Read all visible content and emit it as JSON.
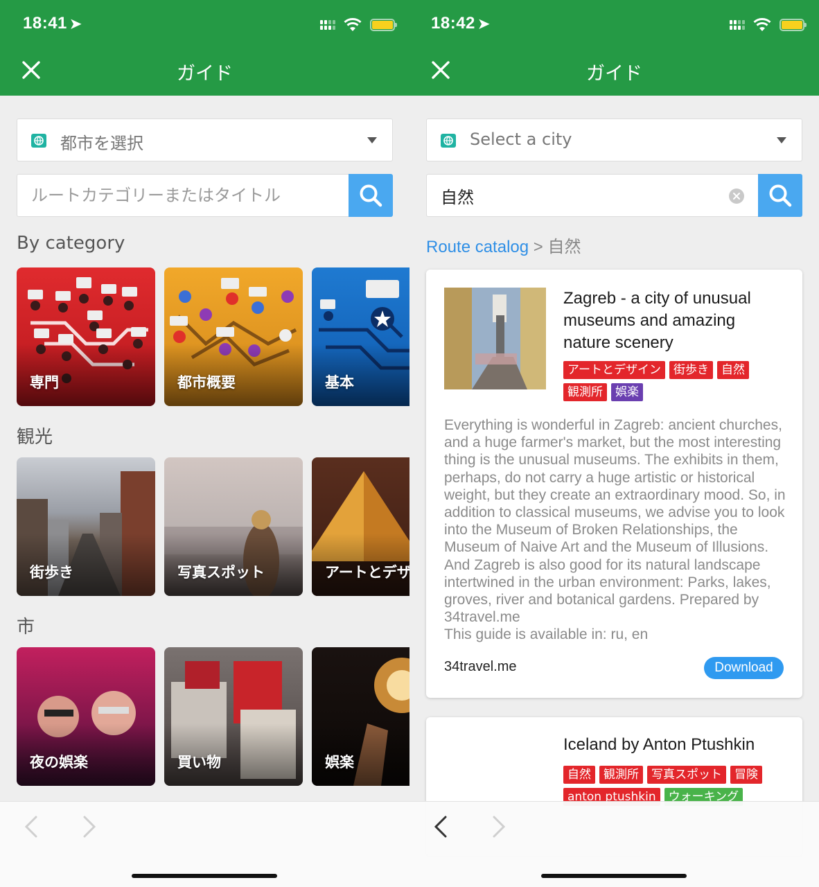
{
  "colors": {
    "header": "#259a45",
    "accent": "#4aa8f0",
    "link": "#2f8fe6",
    "tag_red": "#e3262b",
    "tag_purple": "#6a3fb0",
    "tag_green": "#49b34a",
    "battery": "#f7d11e"
  },
  "left": {
    "status": {
      "time": "18:41"
    },
    "header": {
      "title": "ガイド",
      "close_icon": "close-icon"
    },
    "city_select": {
      "value": "都市を選択"
    },
    "search": {
      "placeholder": "ルートカテゴリーまたはタイトル"
    },
    "sections": [
      {
        "title": "By category",
        "cards": [
          {
            "label": "専門"
          },
          {
            "label": "都市概要"
          },
          {
            "label": "基本"
          }
        ]
      },
      {
        "title": "観光",
        "cards": [
          {
            "label": "街歩き"
          },
          {
            "label": "写真スポット"
          },
          {
            "label": "アートとデザイン"
          }
        ]
      },
      {
        "title": "市",
        "cards": [
          {
            "label": "夜の娯楽"
          },
          {
            "label": "買い物"
          },
          {
            "label": "娯楽"
          }
        ]
      }
    ]
  },
  "right": {
    "status": {
      "time": "18:42"
    },
    "header": {
      "title": "ガイド"
    },
    "city_select": {
      "value": "Select a city"
    },
    "search": {
      "value": "自然"
    },
    "breadcrumb": {
      "link": "Route catalog",
      "separator": ">",
      "current": "自然"
    },
    "routes": [
      {
        "title": "Zagreb - a city of unusual museums and amazing nature scenery",
        "tags": [
          {
            "label": "アートとデザイン",
            "color": "#e3262b"
          },
          {
            "label": "街歩き",
            "color": "#e3262b"
          },
          {
            "label": "自然",
            "color": "#e3262b"
          },
          {
            "label": "観測所",
            "color": "#e3262b"
          },
          {
            "label": "娯楽",
            "color": "#6a3fb0"
          }
        ],
        "description": "Everything is wonderful in Zagreb: ancient churches, and a huge farmer's market, but the most interesting thing is the unusual museums. The exhibits in them, perhaps, do not carry a huge artistic or historical weight, but they create an extraordinary mood. So, in addition to classical museums, we advise you to look into the Museum of Broken Relationships, the Museum of Naive Art and the Museum of Illusions. And Zagreb is also good for its natural landscape intertwined in the urban environment: Parks, lakes, groves, river and botanical gardens. Prepared by 34travel.me",
        "availability": "This guide is available in: ru, en",
        "source": "34travel.me",
        "download_label": "Download"
      },
      {
        "title": "Iceland by Anton Ptushkin",
        "tags": [
          {
            "label": "自然",
            "color": "#e3262b"
          },
          {
            "label": "観測所",
            "color": "#e3262b"
          },
          {
            "label": "写真スポット",
            "color": "#e3262b"
          },
          {
            "label": "冒険",
            "color": "#e3262b"
          },
          {
            "label": "anton ptushkin",
            "color": "#e3262b"
          },
          {
            "label": "ウォーキング",
            "color": "#49b34a"
          }
        ]
      }
    ]
  }
}
